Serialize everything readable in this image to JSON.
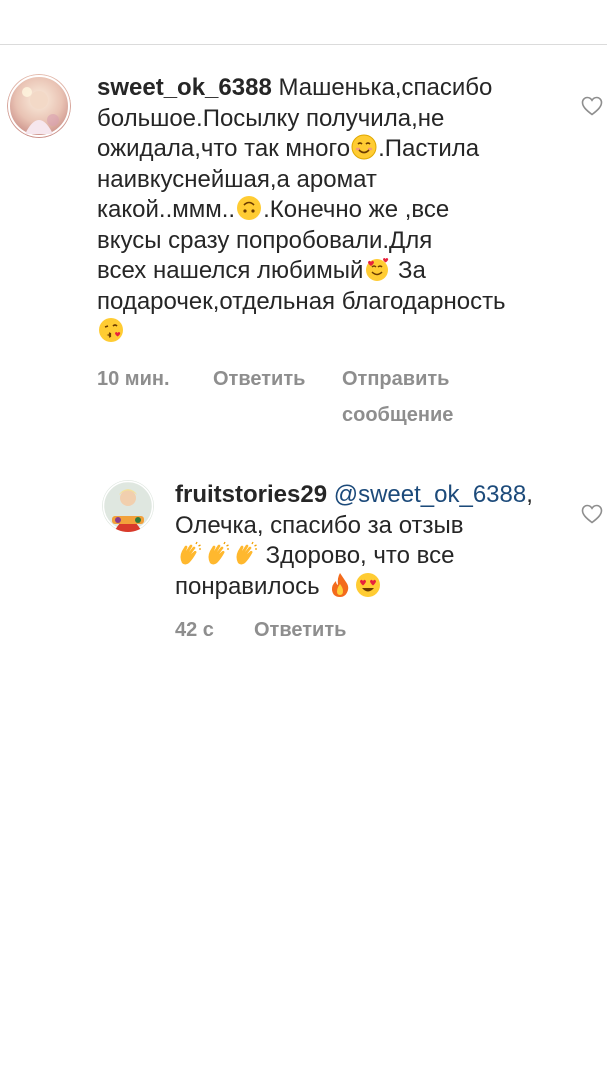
{
  "comments": [
    {
      "username": "sweet_ok_6388",
      "text_lines": [
        "Машенька,спасибо",
        "большое.Посылку получила,не",
        "ожидала,что так много",
        ".Пастила",
        "наивкуснейшая,а аромат",
        "какой..ммм..",
        ".Конечно же ,все",
        "вкусы сразу попробовали.Для",
        "всех нашелся любимый",
        " За",
        "подарочек,отдельная благодарность"
      ],
      "emojis": [
        "smiling-face-emoji",
        "upside-down-face-emoji",
        "smiling-face-with-hearts-emoji",
        "face-blowing-kiss-emoji"
      ],
      "time": "10 мин.",
      "reply_label": "Ответить",
      "send_message_label_1": "Отправить",
      "send_message_label_2": "сообщение"
    },
    {
      "username": "fruitstories29",
      "mention": "@sweet_ok_6388",
      "mention_suffix": ",",
      "text_lines": [
        "Олечка, спасибо за отзыв",
        " Здорово, что все",
        "понравилось "
      ],
      "emojis": [
        "clapping-hands-emoji",
        "clapping-hands-emoji",
        "clapping-hands-emoji",
        "fire-emoji",
        "heart-eyes-emoji"
      ],
      "time": "42 с",
      "reply_label": "Ответить"
    }
  ],
  "colors": {
    "text": "#262626",
    "meta": "#8e8e8e",
    "mention": "#1c4a7a",
    "divider": "#dbdbdb"
  }
}
